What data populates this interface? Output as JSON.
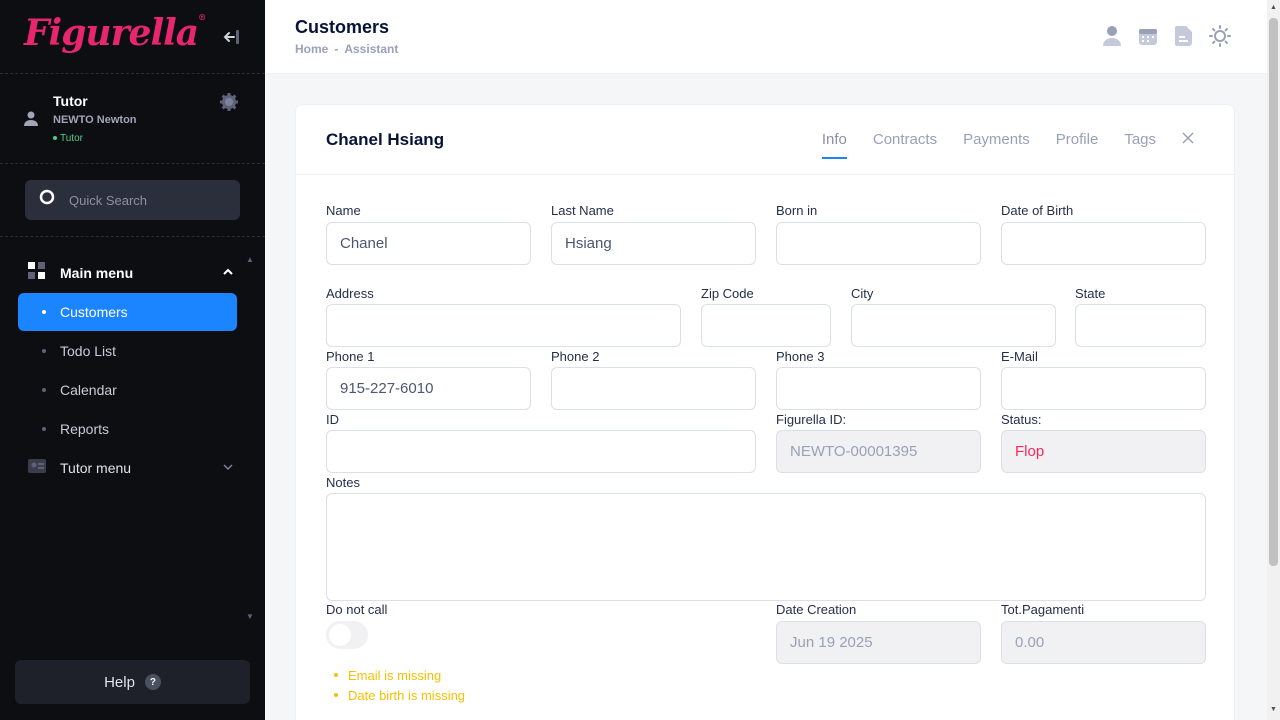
{
  "app": {
    "logo": "Figurella"
  },
  "sidebar": {
    "user": {
      "name": "Tutor",
      "org": "NEWTO Newton",
      "role": "Tutor"
    },
    "search_placeholder": "Quick Search",
    "main_menu": "Main menu",
    "items": [
      {
        "label": "Customers",
        "active": true
      },
      {
        "label": "Todo List"
      },
      {
        "label": "Calendar"
      },
      {
        "label": "Reports"
      }
    ],
    "tutor_menu": "Tutor menu",
    "help": "Help"
  },
  "header": {
    "title": "Customers",
    "breadcrumb": [
      "Home",
      "Assistant"
    ],
    "icons": [
      "user-icon",
      "calendar-icon",
      "document-icon",
      "sun-icon"
    ]
  },
  "customer": {
    "full_name": "Chanel Hsiang",
    "tabs": [
      "Info",
      "Contracts",
      "Payments",
      "Profile",
      "Tags"
    ],
    "active_tab": "Info",
    "labels": {
      "name": "Name",
      "last_name": "Last Name",
      "born_in": "Born in",
      "dob": "Date of Birth",
      "address": "Address",
      "zip": "Zip Code",
      "city": "City",
      "state": "State",
      "phone1": "Phone 1",
      "phone2": "Phone 2",
      "phone3": "Phone 3",
      "email": "E-Mail",
      "id": "ID",
      "figurella_id": "Figurella ID:",
      "status": "Status:",
      "notes": "Notes",
      "do_not_call": "Do not call",
      "date_creation": "Date Creation",
      "tot_pagamenti": "Tot.Pagamenti"
    },
    "values": {
      "name": "Chanel",
      "last_name": "Hsiang",
      "born_in": "",
      "dob": "",
      "address": "",
      "zip": "",
      "city": "",
      "state": "",
      "phone1": "915-227-6010",
      "phone2": "",
      "phone3": "",
      "email": "",
      "id": "",
      "figurella_id": "NEWTO-00001395",
      "status": "Flop",
      "notes": "",
      "do_not_call": false,
      "date_creation": "Jun 19 2025",
      "tot_pagamenti": "0.00"
    },
    "warnings": [
      "Email is missing",
      "Date birth is missing"
    ]
  },
  "colors": {
    "accent": "#1b84ff",
    "brand": "#e8256f",
    "warning": "#f6c000",
    "danger": "#f8285a",
    "sidebar": "#0d0e12"
  }
}
